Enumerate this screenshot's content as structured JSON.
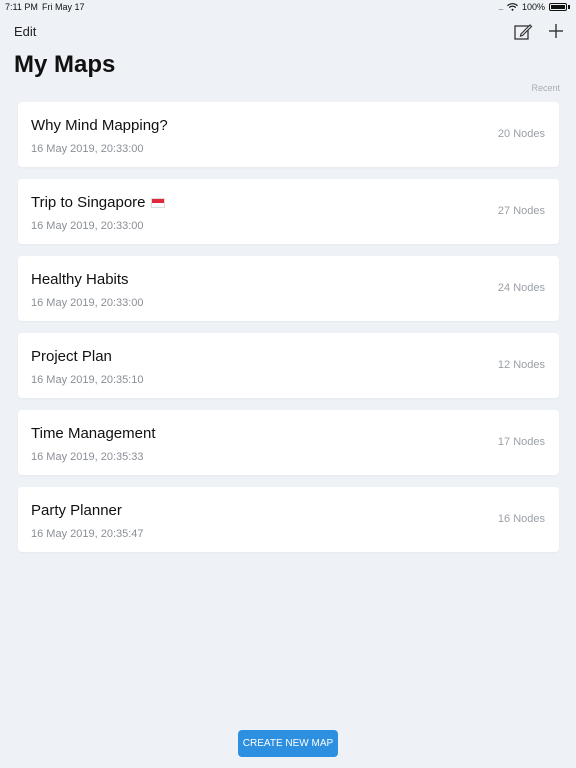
{
  "status_bar": {
    "time": "7:11 PM",
    "date": "Fri May 17",
    "signal": "....",
    "battery": "100%"
  },
  "nav": {
    "edit_label": "Edit",
    "compose_icon": "compose-icon",
    "add_icon": "plus-icon"
  },
  "page": {
    "title": "My Maps",
    "sort_label": "Recent"
  },
  "maps": [
    {
      "title": "Why Mind Mapping?",
      "date": "16 May 2019, 20:33:00",
      "nodes": "20 Nodes",
      "flag": false
    },
    {
      "title": "Trip to Singapore",
      "date": "16 May 2019, 20:33:00",
      "nodes": "27 Nodes",
      "flag": true
    },
    {
      "title": "Healthy Habits",
      "date": "16 May 2019, 20:33:00",
      "nodes": "24 Nodes",
      "flag": false
    },
    {
      "title": "Project Plan",
      "date": "16 May 2019, 20:35:10",
      "nodes": "12 Nodes",
      "flag": false
    },
    {
      "title": "Time Management",
      "date": "16 May 2019, 20:35:33",
      "nodes": "17 Nodes",
      "flag": false
    },
    {
      "title": "Party Planner",
      "date": "16 May 2019, 20:35:47",
      "nodes": "16 Nodes",
      "flag": false
    }
  ],
  "footer": {
    "create_label": "CREATE NEW MAP"
  },
  "colors": {
    "background": "#eef2f7",
    "accent": "#2c8fdf",
    "card": "#ffffff"
  }
}
